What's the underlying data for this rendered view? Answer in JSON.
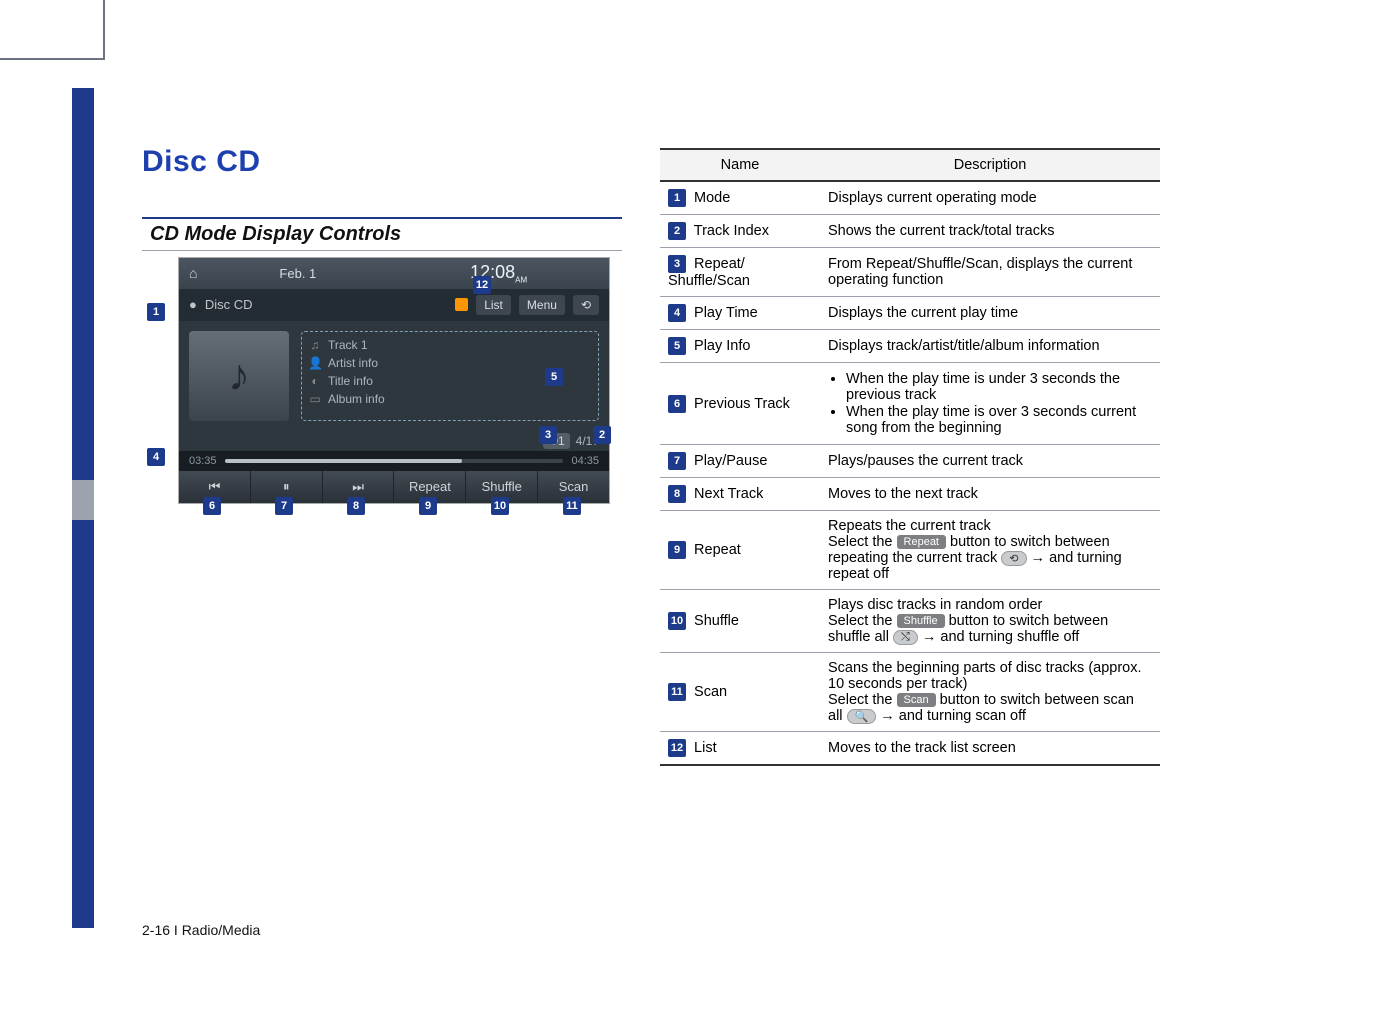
{
  "page": {
    "title": "Disc CD",
    "subtitle": "CD Mode Display Controls",
    "footer": "2-16 I Radio/Media"
  },
  "screenshot": {
    "home_icon": "⌂",
    "date": "Feb. 1",
    "time": "12:08",
    "time_ampm": "AM",
    "mode_icon": "●",
    "mode_label": "Disc CD",
    "list_btn": "List",
    "menu_btn": "Menu",
    "cover_glyph": "♪",
    "info": {
      "track": "Track 1",
      "artist": "Artist info",
      "title": "Title info",
      "album": "Album info"
    },
    "repeat_icon_pill": "⟲1",
    "track_index": "4/17",
    "elapsed": "03:35",
    "total": "04:35",
    "controls": {
      "prev": "⏮",
      "pause": "⏸",
      "next": "⏭",
      "repeat": "Repeat",
      "shuffle": "Shuffle",
      "scan": "Scan"
    }
  },
  "callouts": {
    "c1": "1",
    "c2": "2",
    "c3": "3",
    "c4": "4",
    "c5": "5",
    "c6": "6",
    "c7": "7",
    "c8": "8",
    "c9": "9",
    "c10": "10",
    "c11": "11",
    "c12": "12"
  },
  "table": {
    "header_name": "Name",
    "header_desc": "Description",
    "rows": [
      {
        "num": "1",
        "name": "Mode",
        "desc": "Displays current operating mode"
      },
      {
        "num": "2",
        "name": "Track Index",
        "desc": "Shows the current track/total tracks"
      },
      {
        "num": "3",
        "name": "Repeat/ Shuffle/Scan",
        "desc": "From Repeat/Shuffle/Scan, displays the current operating function"
      },
      {
        "num": "4",
        "name": "Play Time",
        "desc": "Displays the current play time"
      },
      {
        "num": "5",
        "name": "Play Info",
        "desc": "Displays track/artist/title/album information"
      },
      {
        "num": "6",
        "name": "Previous Track",
        "bullets": [
          "When the play time is under 3 seconds the previous track",
          "When the play time is over 3 seconds current song from the beginning"
        ]
      },
      {
        "num": "7",
        "name": "Play/Pause",
        "desc": "Plays/pauses the current track"
      },
      {
        "num": "8",
        "name": "Next Track",
        "desc": "Moves to the next track"
      },
      {
        "num": "9",
        "name": "Repeat",
        "desc_parts": {
          "p1": "Repeats the current track",
          "p2a": "Select the ",
          "btn1": "Repeat",
          "p2b": " button to switch between repeating the current track ",
          "icon1": "⟲",
          "p2c": " → and turning repeat off"
        }
      },
      {
        "num": "10",
        "name": "Shuffle",
        "desc_parts": {
          "p1": "Plays disc tracks in random order",
          "p2a": "Select the ",
          "btn1": "Shuffle",
          "p2b": " button to switch between shuffle all  ",
          "icon1": "⤭",
          "p2c": " →  and turning shuffle off"
        }
      },
      {
        "num": "11",
        "name": "Scan",
        "desc_parts": {
          "p1": "Scans the beginning parts of disc tracks (approx. 10 seconds per track)",
          "p2a": "Select the ",
          "btn1": "Scan",
          "p2b": " button to switch between scan all  ",
          "icon1": "🔍",
          "p2c": " → and turning scan off"
        }
      },
      {
        "num": "12",
        "name": "List",
        "desc": "Moves to the track list screen"
      }
    ]
  }
}
